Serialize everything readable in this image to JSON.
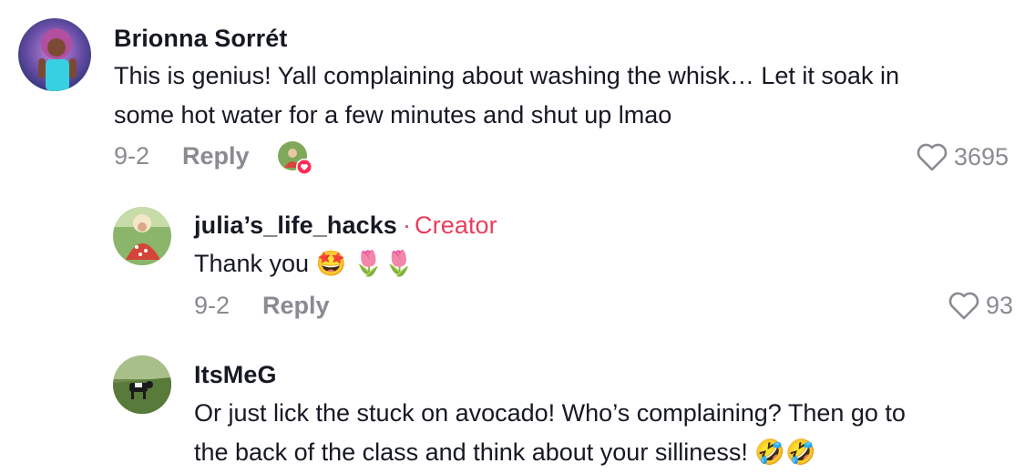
{
  "comments": [
    {
      "username": "Brionna Sorrét",
      "line1": "This is genius! Yall complaining about washing the whisk… Let it soak in",
      "line2": "some hot water for a few minutes and shut up lmao",
      "date": "9-2",
      "reply_label": "Reply",
      "likes": "3695",
      "liked_by_creator": true
    },
    {
      "username": "julia’s_life_hacks",
      "badge": "Creator",
      "line1": "Thank you 🤩 🌷🌷",
      "date": "9-2",
      "reply_label": "Reply",
      "likes": "93"
    },
    {
      "username": "ItsMeG",
      "line1": "Or just lick the stuck on avocado! Who’s complaining? Then go to",
      "line2": "the back of the class and think about your silliness! 🤣🤣"
    }
  ],
  "colors": {
    "text": "#161823",
    "muted": "#8a8b91",
    "creator": "#e83e5c",
    "like_badge": "#fe2c55"
  }
}
